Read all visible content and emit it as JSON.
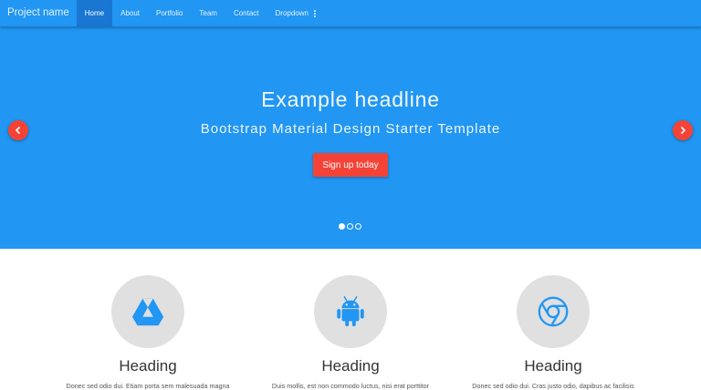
{
  "navbar": {
    "brand": "Project name",
    "items": [
      {
        "label": "Home",
        "active": true
      },
      {
        "label": "About",
        "active": false
      },
      {
        "label": "Portfolio",
        "active": false
      },
      {
        "label": "Team",
        "active": false
      },
      {
        "label": "Contact",
        "active": false
      },
      {
        "label": "Dropdown",
        "active": false
      }
    ]
  },
  "hero": {
    "headline": "Example headline",
    "subheadline": "Bootstrap Material Design Starter Template",
    "cta_label": "Sign up today",
    "slide_count": 3,
    "active_slide": 1
  },
  "features": [
    {
      "icon": "google-drive-icon",
      "heading": "Heading",
      "text": "Donec sed odio dui. Etiam porta sem malesuada magna"
    },
    {
      "icon": "android-icon",
      "heading": "Heading",
      "text": "Duis mollis, est non commodo luctus, nisi erat porttitor"
    },
    {
      "icon": "chrome-icon",
      "heading": "Heading",
      "text": "Donec sed odio dui. Cras justo odio, dapibus ac facilisis"
    }
  ],
  "colors": {
    "primary": "#2196f3",
    "primary_dark": "#1976d2",
    "accent": "#f44336",
    "icon_circle": "#e0e0e0"
  }
}
